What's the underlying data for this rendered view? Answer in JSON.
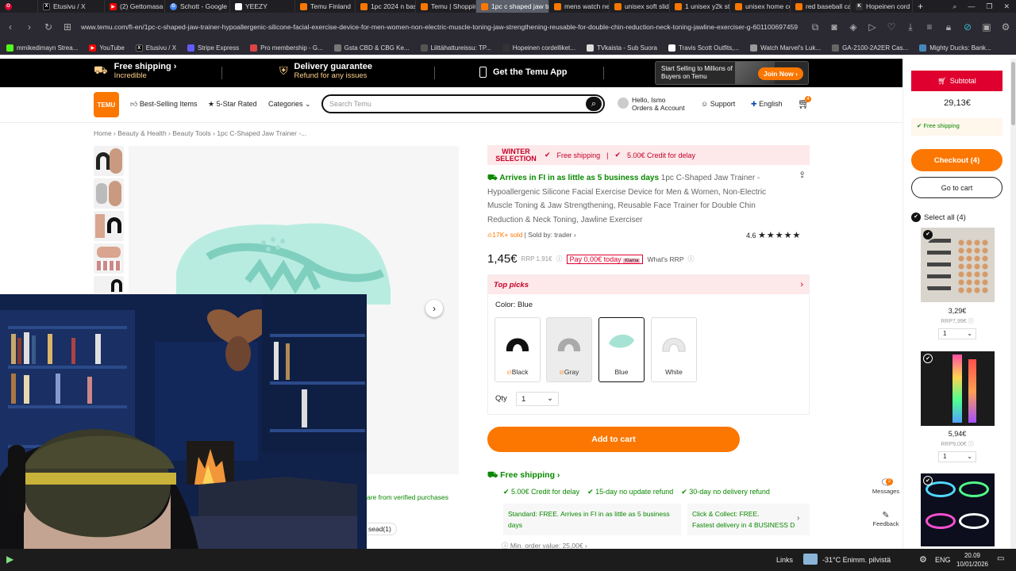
{
  "browser": {
    "tabs": [
      {
        "label": "Etusivu / X",
        "icon_color": "#000"
      },
      {
        "label": "(2) Gettomasa",
        "icon_color": "#ff0000"
      },
      {
        "label": "Schott - Google",
        "icon_color": "#4285f4"
      },
      {
        "label": "YEEZY",
        "icon_color": "#fff"
      },
      {
        "label": "Temu Finland",
        "icon_color": "#fb7701"
      },
      {
        "label": "1pc 2024 n bas",
        "icon_color": "#fb7701"
      },
      {
        "label": "Temu | Shoppin",
        "icon_color": "#fb7701"
      },
      {
        "label": "1pc c shaped jaw trainer",
        "icon_color": "#fb7701"
      },
      {
        "label": "mens watch ne",
        "icon_color": "#fb7701"
      },
      {
        "label": "unisex soft slid",
        "icon_color": "#fb7701"
      },
      {
        "label": "1 unisex y2k sty",
        "icon_color": "#fb7701"
      },
      {
        "label": "unisex home co",
        "icon_color": "#fb7701"
      },
      {
        "label": "red baseball ca",
        "icon_color": "#fb7701"
      },
      {
        "label": "Hopeinen cord",
        "icon_color": "#333"
      }
    ],
    "url": "www.temu.com/fi-en/1pc-c-shaped-jaw-trainer-hypoallergenic-silicone-facial-exercise-device-for-men-women-non-electric-muscle-toning-jaw-strengthening-reusable-for-double-chin-reduction-neck-toning-jawline-exerciser-g-601100697459",
    "bookmarks": [
      "mmikedimayn Strea...",
      "YouTube",
      "Etusivu / X",
      "Stripe Express",
      "Pro membership - G...",
      "Gsta CBD & CBG Ke...",
      "Liittähattureissu: TP...",
      "Hopeinen cordelliket...",
      "TVkaista - Sub Suora",
      "Travis Scott Outfits,...",
      "Watch Marvel's Luk...",
      "GA-2100-2A2ER Cas...",
      "Mighty Ducks: Bank..."
    ]
  },
  "promo": {
    "free_shipping": "Free shipping",
    "free_shipping_sub": "Incredible",
    "delivery": "Delivery guarantee",
    "delivery_sub": "Refund for any issues",
    "app": "Get the Temu App",
    "sell_title": "Start Selling to Millions of Buyers on Temu",
    "join": "Join Now"
  },
  "header": {
    "logo": "TEMU",
    "nav": [
      "Best-Selling Items",
      "5-Star Rated",
      "Categories"
    ],
    "search_placeholder": "Search Temu",
    "account_1": "Hello, Ismo",
    "account_2": "Orders & Account",
    "support": "Support",
    "language": "English",
    "cart_count": "4"
  },
  "breadcrumb": [
    "Home",
    "Beauty & Health",
    "Beauty Tools",
    "1pc C-Shaped Jaw Trainer -..."
  ],
  "product": {
    "badge_title": "WINTER SELECTION",
    "banner_free": "Free shipping",
    "banner_credit": "5.00€ Credit for delay",
    "arrives": "Arrives in FI in as little as 5 business days",
    "title": " 1pc C-Shaped Jaw Trainer - Hypoallergenic Silicone Facial Exercise Device for Men & Women, Non-Electric Muscle Toning & Jaw Strengthening, Reusable Face Trainer for Double Chin Reduction & Neck Toning, Jawline Exerciser",
    "sold": "17K+ sold",
    "seller": "Sold by: trader",
    "rating": "4.6",
    "price": "1,45€",
    "rrp": "RRP 1,91€",
    "pay_today": "Pay 0,00€ today",
    "klarna": "Klarna",
    "whats_rrp": "What's RRP",
    "top_picks": "Top picks",
    "color_label": "Color: Blue",
    "colors": [
      "Black",
      "Gray",
      "Blue",
      "White"
    ],
    "qty_label": "Qty",
    "qty_value": "1",
    "add_to_cart": "Add to cart",
    "free_shipping_link": "Free shipping",
    "guarantees": [
      "5.00€ Credit for delay",
      "15-day no update refund",
      "30-day no delivery refund"
    ],
    "standard": "Standard: FREE. Arrives in FI in as little as 5 business days",
    "collect_1": "Click & Collect: FREE.",
    "collect_2": "Fastest delivery in 4 BUSINESS D",
    "min_order": "Min. order value: 25,00€",
    "verified": "are from verified purchases",
    "reviews_tab": "sead(1)"
  },
  "cart": {
    "subtotal_label": "Subtotal",
    "subtotal": "29,13€",
    "free_shipping": "Free shipping",
    "checkout": "Checkout (4)",
    "go_to_cart": "Go to cart",
    "select_all": "Select all (4)",
    "items": [
      {
        "price": "3,29€",
        "rrp": "RRP7,99€",
        "qty": "1"
      },
      {
        "price": "5,94€",
        "rrp": "RRP9,00€",
        "qty": "1"
      }
    ],
    "messages": "Messages",
    "messages_count": "2",
    "feedback": "Feedback"
  },
  "taskbar": {
    "links": "Links",
    "weather": "-31°C Enimm. pilvistä",
    "lang": "ENG",
    "time": "20.09",
    "date": "10/01/2026"
  },
  "colors": {
    "accent": "#fb7701",
    "green": "#0a8800",
    "red": "#e0002f"
  }
}
